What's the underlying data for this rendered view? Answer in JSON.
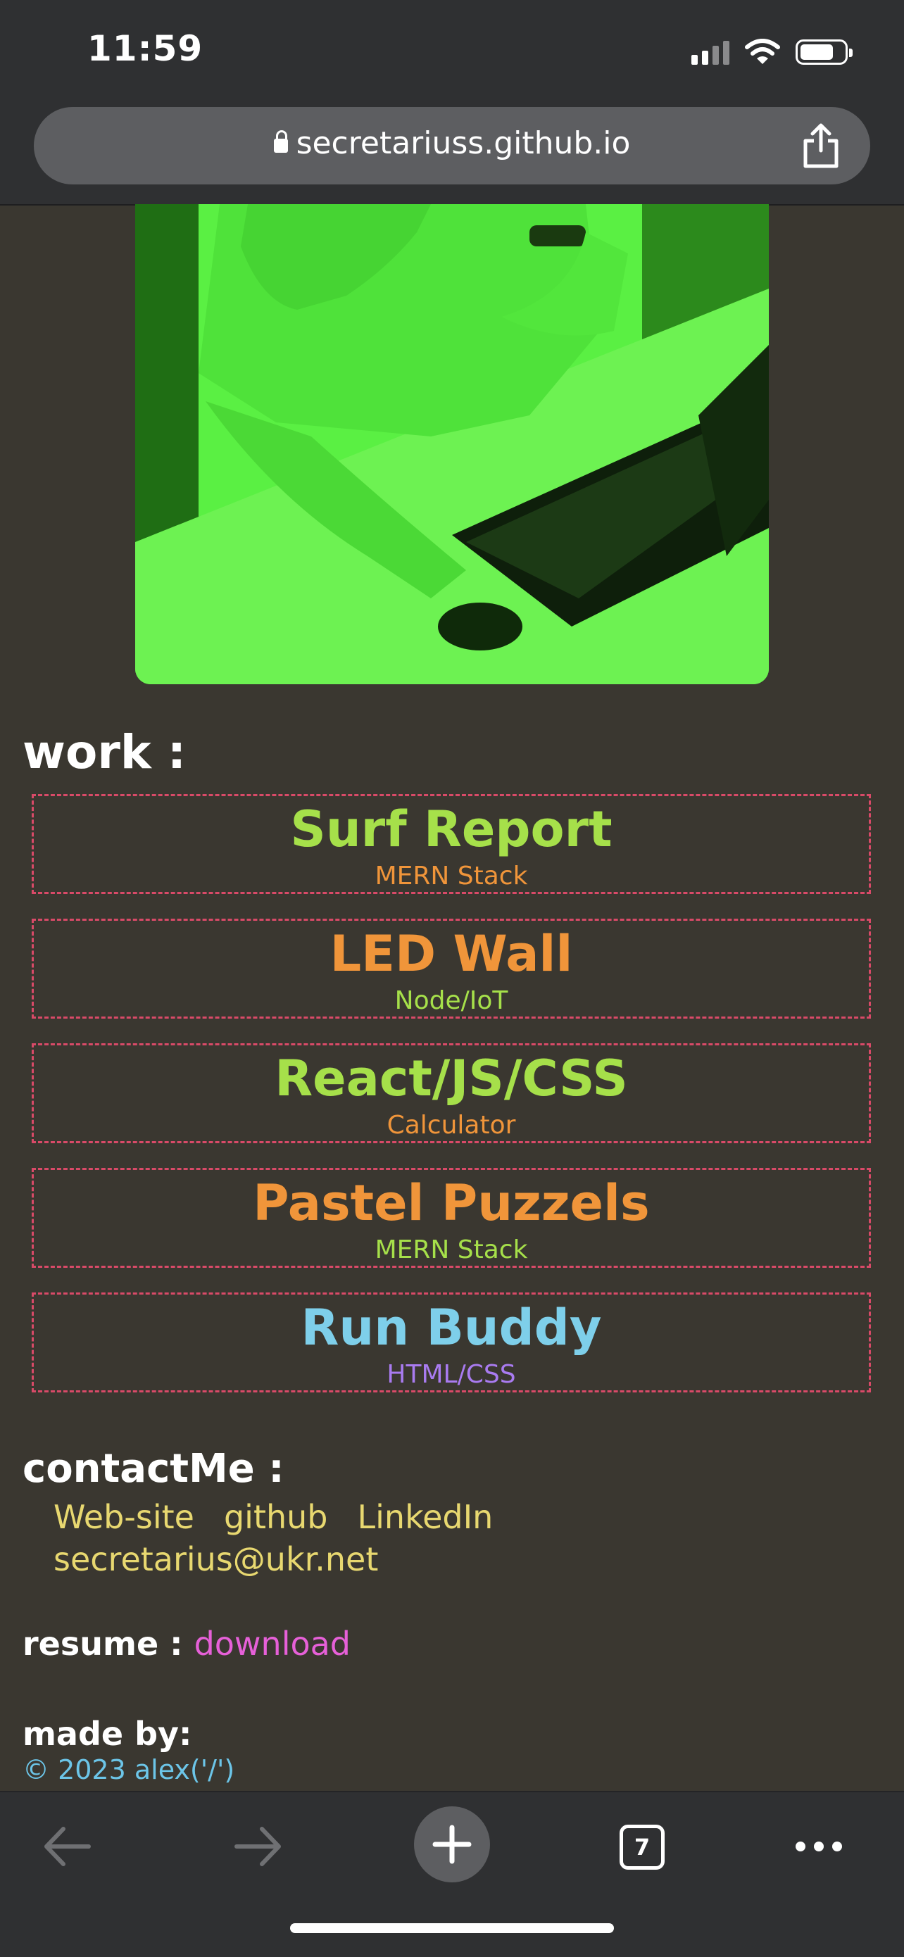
{
  "status_bar": {
    "time": "11:59"
  },
  "browser": {
    "url": "secretariuss.github.io",
    "tab_count": "7"
  },
  "photo": {
    "description_icon": "portrait-photo"
  },
  "work": {
    "heading": "work :",
    "projects": [
      {
        "title": "Surf Report",
        "subtitle": "MERN Stack",
        "title_color": "#a6e04a",
        "subtitle_color": "#f0953a"
      },
      {
        "title": "LED Wall",
        "subtitle": "Node/IoT",
        "title_color": "#f0953a",
        "subtitle_color": "#a6e04a"
      },
      {
        "title": "React/JS/CSS",
        "subtitle": "Calculator",
        "title_color": "#a6e04a",
        "subtitle_color": "#f0953a"
      },
      {
        "title": "Pastel Puzzels",
        "subtitle": "MERN Stack",
        "title_color": "#f0953a",
        "subtitle_color": "#a6e04a"
      },
      {
        "title": "Run Buddy",
        "subtitle": "HTML/CSS",
        "title_color": "#7ecfea",
        "subtitle_color": "#a97bf0"
      }
    ]
  },
  "contact": {
    "heading": "contactMe :",
    "links": [
      "Web-site",
      "github",
      "LinkedIn"
    ],
    "email": "secretarius@ukr.net"
  },
  "resume": {
    "label": "resume :",
    "link": "download"
  },
  "footer": {
    "heading": "made by:",
    "copyright": "© 2023 alex('/')"
  },
  "colors": {
    "background": "#3a3730",
    "card_border": "#d94a68",
    "contact": "#e8d870",
    "resume_link": "#e660d8",
    "copyright": "#6cc5e8"
  }
}
